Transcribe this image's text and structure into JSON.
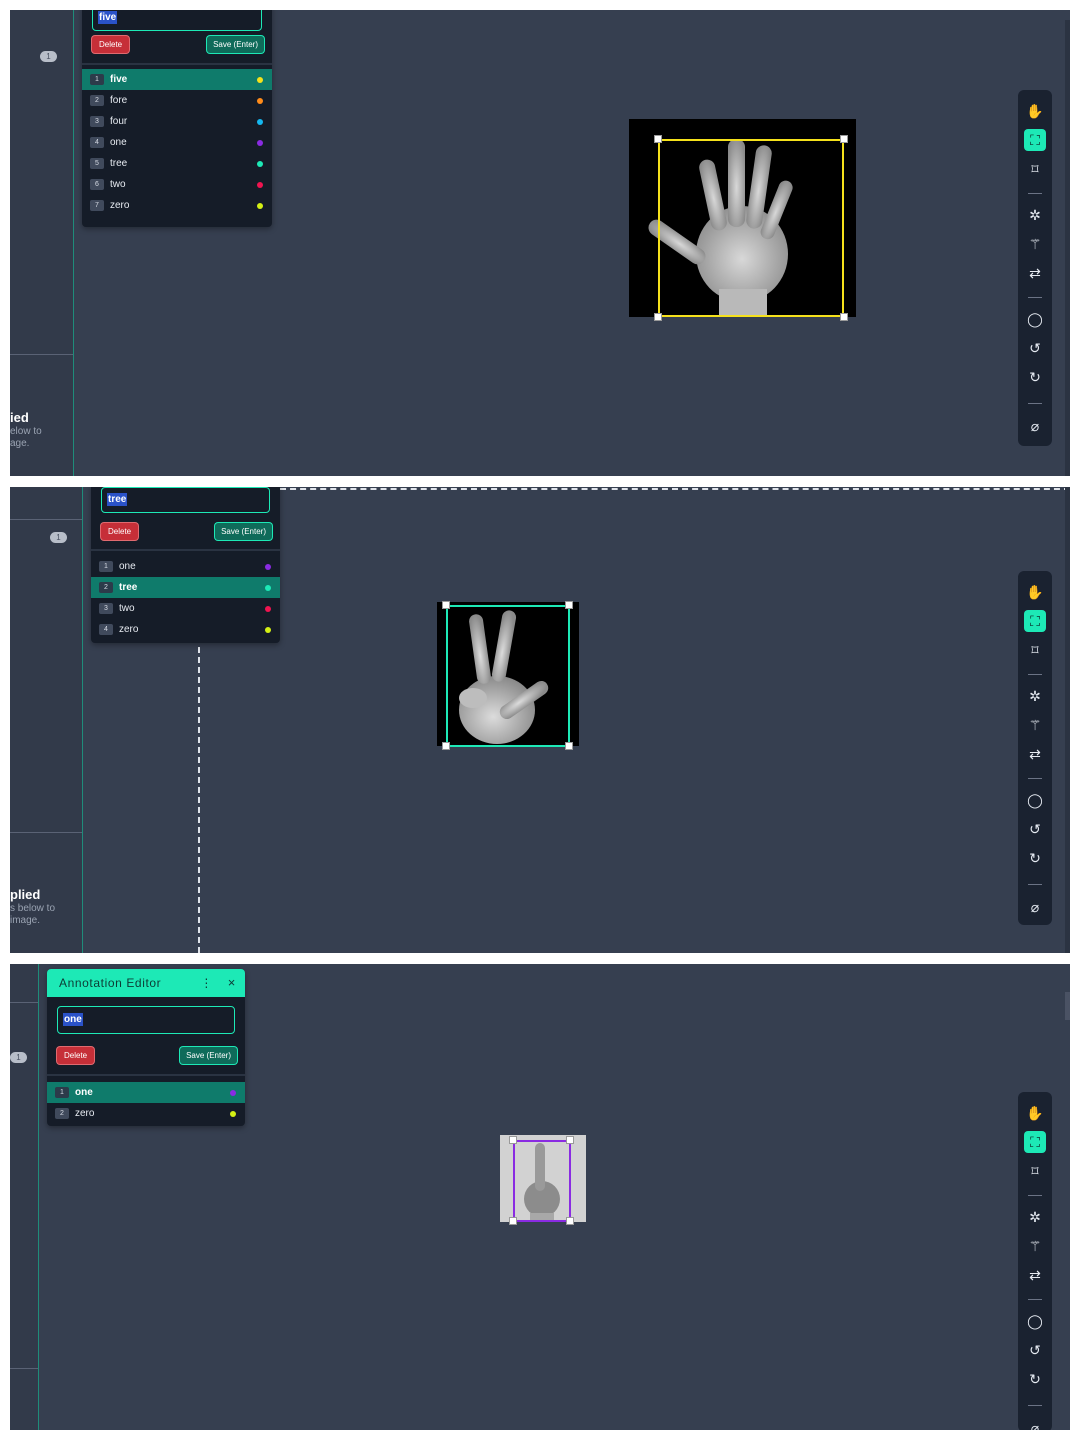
{
  "panel1": {
    "sidebar": {
      "badge": "1",
      "title": "ied",
      "lines": [
        "elow to",
        "age."
      ]
    },
    "editor": {
      "input_value": "five",
      "delete_label": "Delete",
      "save_label": "Save (Enter)",
      "labels": [
        {
          "num": "1",
          "name": "five",
          "color": "#f5e11b",
          "selected": true
        },
        {
          "num": "2",
          "name": "fore",
          "color": "#ff8c1a",
          "selected": false
        },
        {
          "num": "3",
          "name": "four",
          "color": "#14b7f0",
          "selected": false
        },
        {
          "num": "4",
          "name": "one",
          "color": "#8a2be2",
          "selected": false
        },
        {
          "num": "5",
          "name": "tree",
          "color": "#1de9b6",
          "selected": false
        },
        {
          "num": "6",
          "name": "two",
          "color": "#f01450",
          "selected": false
        },
        {
          "num": "7",
          "name": "zero",
          "color": "#d4f014",
          "selected": false
        }
      ]
    },
    "annotation": {
      "label": "five",
      "color": "#f5e11b"
    }
  },
  "panel2": {
    "sidebar": {
      "badge": "1",
      "title": "plied",
      "lines": [
        "s below to",
        "image."
      ]
    },
    "editor": {
      "input_value": "tree",
      "delete_label": "Delete",
      "save_label": "Save (Enter)",
      "labels": [
        {
          "num": "1",
          "name": "one",
          "color": "#8a2be2",
          "selected": false
        },
        {
          "num": "2",
          "name": "tree",
          "color": "#1de9b6",
          "selected": true
        },
        {
          "num": "3",
          "name": "two",
          "color": "#f01450",
          "selected": false
        },
        {
          "num": "4",
          "name": "zero",
          "color": "#d4f014",
          "selected": false
        }
      ]
    },
    "annotation": {
      "label": "tree",
      "color": "#1de9b6"
    }
  },
  "panel3": {
    "sidebar": {
      "badge": "1"
    },
    "editor": {
      "title": "Annotation Editor",
      "menu_icon": "⋮",
      "close_icon": "×",
      "input_value": "one",
      "delete_label": "Delete",
      "save_label": "Save (Enter)",
      "labels": [
        {
          "num": "1",
          "name": "one",
          "color": "#8a2be2",
          "selected": true
        },
        {
          "num": "2",
          "name": "zero",
          "color": "#d4f014",
          "selected": false
        }
      ]
    },
    "annotation": {
      "label": "one",
      "color": "#8a2be2"
    }
  },
  "toolbar": {
    "tools": [
      {
        "icon": "pan-hand-icon",
        "glyph": "✋",
        "active": false
      },
      {
        "icon": "bounding-box-icon",
        "glyph": "⛶",
        "active": true
      },
      {
        "icon": "polygon-icon",
        "glyph": "⌑",
        "active": false
      },
      {
        "icon": "auto-annotate-icon",
        "glyph": "✲",
        "active": false
      },
      {
        "icon": "magic-wand-icon",
        "glyph": "⚚",
        "active": false
      },
      {
        "icon": "repeat-icon",
        "glyph": "⇄",
        "active": false
      },
      {
        "icon": "comment-icon",
        "glyph": "◯",
        "active": false
      },
      {
        "icon": "undo-icon",
        "glyph": "↺",
        "active": false
      },
      {
        "icon": "redo-icon",
        "glyph": "↻",
        "active": false
      },
      {
        "icon": "clear-icon",
        "glyph": "⌀",
        "active": false
      }
    ]
  },
  "colors": {
    "canvas_bg": "#363f50",
    "accent": "#1de9b6",
    "delete": "#c62f38",
    "editor_bg": "#151c28"
  }
}
